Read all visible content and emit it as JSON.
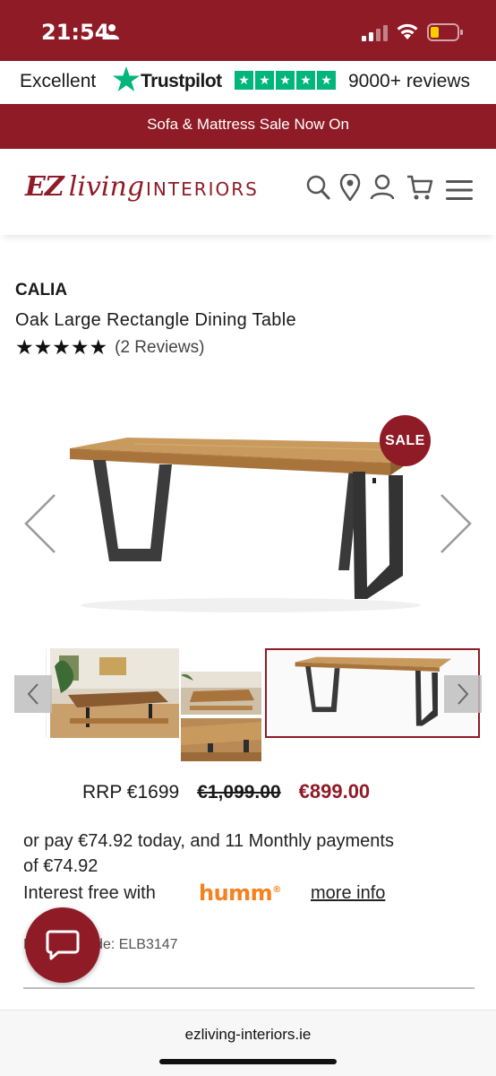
{
  "status_bar": {
    "time": "21:54"
  },
  "trustpilot": {
    "rating_word": "Excellent",
    "brand": "Trustpilot",
    "reviews": "9000+ reviews",
    "star_glyph": "★"
  },
  "promo": {
    "text": "Sofa & Mattress Sale Now On"
  },
  "header": {
    "logo": {
      "ez": "EZ",
      "living": "living",
      "interiors": "INTERIORS"
    },
    "icons": [
      "search-icon",
      "location-pin-icon",
      "account-icon",
      "cart-icon",
      "menu-icon"
    ]
  },
  "product": {
    "brand": "CALIA",
    "title": "Oak Large Rectangle Dining Table",
    "rating_stars": 5,
    "star_glyph": "★",
    "reviews_label": "(2 Reviews)",
    "sale_badge": "SALE",
    "thumbnail_count": 4
  },
  "pricing": {
    "rrp": "RRP €1699",
    "was": "€1,099.00",
    "now": "€899.00"
  },
  "finance": {
    "line1": "or pay €74.92 today, and 11 Monthly payments",
    "line2": "of €74.92",
    "interest_free": "Interest free with",
    "provider": "humm",
    "provider_mark": "®",
    "more_info": "more info"
  },
  "product_code": {
    "text": "Product Code: ELB3147"
  },
  "browser": {
    "url": "ezliving-interiors.ie"
  },
  "colors": {
    "brand": "#8f1b26",
    "trustpilot": "#00b67a",
    "humm": "#f5821f"
  }
}
